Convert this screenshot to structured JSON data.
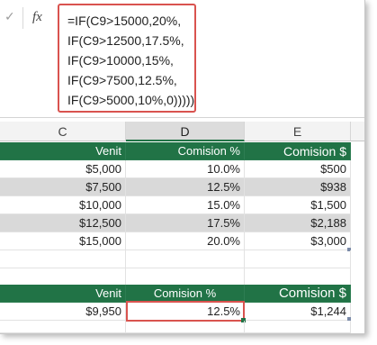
{
  "formula_bar": {
    "cancel_icon": "check-icon",
    "fx_label": "fx",
    "lines": [
      "=IF(C9>15000,20%,",
      "IF(C9>12500,17.5%,",
      "IF(C9>10000,15%,",
      "IF(C9>7500,12.5%,",
      "IF(C9>5000,10%,0)))))"
    ]
  },
  "columns": {
    "c": "C",
    "d": "D",
    "e": "E"
  },
  "table1": {
    "headers": [
      "Venit",
      "Comision %",
      "Comision $"
    ],
    "rows": [
      [
        "$5,000",
        "10.0%",
        "$500"
      ],
      [
        "$7,500",
        "12.5%",
        "$938"
      ],
      [
        "$10,000",
        "15.0%",
        "$1,500"
      ],
      [
        "$12,500",
        "17.5%",
        "$2,188"
      ],
      [
        "$15,000",
        "20.0%",
        "$3,000"
      ]
    ]
  },
  "table2": {
    "headers": [
      "Venit",
      "Comision %",
      "Comision $"
    ],
    "row": [
      "$9,950",
      "12.5%",
      "$1,244"
    ]
  },
  "colors": {
    "header_green": "#217346",
    "band_gray": "#d9d9d9",
    "highlight_red": "#d9534f"
  }
}
